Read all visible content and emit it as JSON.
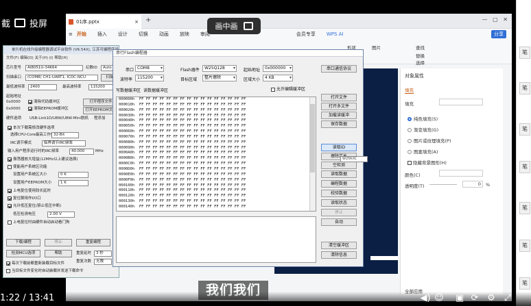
{
  "overlay": {
    "top_left_text_1": "截",
    "top_left_text_2": "投屏",
    "pip_label": "画中画",
    "subtitle": "我们我们",
    "timecode": "1:22 / 13:41"
  },
  "wps": {
    "file_tab": "01序.pptx",
    "ribbon_tabs": [
      "开始",
      "插入",
      "设计",
      "切换",
      "动画",
      "放映",
      "审阅"
    ],
    "ribbon_right": "会员专享",
    "wps_ai": "WPS AI",
    "share_label": "分享",
    "toolbar_items": [
      "形状",
      "图片",
      "查找",
      "替换",
      "选择"
    ],
    "panel_title": "对象属性",
    "panel_tab": "填充",
    "fill_label": "填充",
    "fill_options": [
      "纯色填充(S)",
      "渐变填充(G)",
      "图片或纹理填充(P)",
      "图案填充(A)",
      "隐藏背景图形(H)"
    ],
    "color_label": "颜色(C)",
    "transparency_label": "透明度(T)",
    "transparency_value": "0",
    "transparency_unit": "%",
    "apply_all": "全部应用"
  },
  "oldwin": {
    "title": "单片机在线升级编程器调试平台软件 (V6.54X), 江苏可编程序设备有限公司",
    "menu": "文件(F)  编辑(O)  关于(H)  (I)  帮助(H)",
    "chip_label": "芯片型号",
    "chip_value": "AI8051U-34K64",
    "chip_id_label": "幻数ID",
    "chip_id_value": "Auto",
    "scan_label": "扫描串口",
    "port_value": "(COM8) CH1-UART1, ICDC-NCU",
    "scan_btn": "扫描",
    "min_baud_label": "最低波特率",
    "min_baud_value": "2400",
    "max_baud_label": "最高波特率",
    "max_baud_value": "115200",
    "start_addr_label": "起始地址",
    "addr1": "0x0000",
    "addr2": "0x0000",
    "clear_code": "清除代码缓冲区",
    "clear_eeprom": "清除EEPROM缓冲区",
    "open_prog": "打开程序文件",
    "open_eeprom": "打开EEPROM文件",
    "hw_opts": "硬件选项",
    "usb_link": "USB-Link1D/U8W/U8W-Mini脱机",
    "prog_enc": "程序加",
    "opt1": "本次下载需修改硬件选项",
    "opt_cpu": "选择CPU-Core最高工作频率",
    "irc_label": "IRC频率",
    "irc_value": "32-Bit",
    "adj_label": "IRC调节模式",
    "adj_value": "临界调节IRC频率",
    "input_freq_label": "输入用户程序运行时的IRC频率",
    "input_freq_value": "40.000",
    "mhz": "MHz",
    "opt_vol": "振荡器放大增益(12MHz以上建议选择)",
    "opt_sys": "使能用户系统区功能",
    "sys_size_label": "设置用户系统区大小",
    "sys_size_value": "0 K",
    "eeprom_label": "设置用户EEPROM大小",
    "eeprom_value": "1 K",
    "opt_reset": "上电复位使用较长延时",
    "opt_p54": "复位脚用作I/O口",
    "opt_lvd": "允许低压复位(禁止低压中断)",
    "lvd_label": "低压检测电压",
    "lvd_value": "2.00 V",
    "opt_clear": "上电复位时由硬件自动启动看门狗",
    "download_btn": "下载/编程",
    "stop_btn": "停止",
    "reprog_btn": "重复编程",
    "check_mcu_btn": "检测MCU选项",
    "help_btn": "帮助",
    "repeat_delay_label": "重复延时",
    "repeat_delay_value": "3 秒",
    "repeat_count_label": "重复次数",
    "repeat_count_value": "无限",
    "reload_opt": "每次下载前都重新装载目标文件",
    "auto_send_opt": "当目标文件变化时自动装载并发送下载命令"
  },
  "dialog": {
    "title": "串行Flash编程器",
    "port_label": "串口",
    "port_value": "COM8",
    "baud_label": "波特率",
    "baud_value": "115200",
    "flash_label": "Flash器件",
    "flash_value": "W25Q128",
    "target_label": "目标区域",
    "target_value": "整片擦除",
    "start_label": "起始地址",
    "start_value": "0x000000",
    "size_label": "区域大小",
    "size_value": "4 KB",
    "comm_btn": "串口通信协议",
    "write_buf_label": "写数据缓冲区",
    "read_buf_label": "读数据缓冲区",
    "allow_edit": "允许编辑缓冲区",
    "right_buttons": [
      "打开文件",
      "打开多文件",
      "加载读缓冲",
      "保存数据",
      "读取ID",
      "擦除芯片",
      "空检测",
      "读取数据",
      "编程数据",
      "校验数据",
      "读取状态",
      "停止",
      "自动",
      "清空缓冲区",
      "清除信息"
    ],
    "hex_rows": [
      {
        "addr": "000000h",
        "data": "FF FF FF FF FF FF FF FF FF FF FF FF FF FF FF FF"
      },
      {
        "addr": "000010h",
        "data": "FF FF FF FF FF FF FF FF FF FF FF FF FF FF FF FF"
      },
      {
        "addr": "000020h",
        "data": "FF FF FF FF FF FF FF FF FF FF FF FF FF FF FF FF"
      },
      {
        "addr": "000030h",
        "data": "FF FF FF FF FF FF FF FF FF FF FF FF FF FF FF FF"
      },
      {
        "addr": "000040h",
        "data": "FF FF FF FF FF FF FF FF FF FF FF FF FF FF FF FF"
      },
      {
        "addr": "000050h",
        "data": "FF FF FF FF FF FF FF FF FF FF FF FF FF FF FF FF"
      },
      {
        "addr": "000060h",
        "data": "FF FF FF FF FF FF FF FF FF FF FF FF FF FF FF FF"
      },
      {
        "addr": "000070h",
        "data": "FF FF FF FF FF FF FF FF FF FF FF FF FF FF FF FF"
      },
      {
        "addr": "000080h",
        "data": "FF FF FF FF FF FF FF FF FF FF FF FF FF FF FF FF"
      },
      {
        "addr": "000090h",
        "data": "FF FF FF FF FF FF FF FF FF FF FF FF FF FF FF FF"
      },
      {
        "addr": "0000A0h",
        "data": "FF FF FF FF FF FF FF FF FF FF FF FF FF FF FF FF"
      },
      {
        "addr": "0000B0h",
        "data": "FF FF FF FF FF FF FF FF FF FF FF FF FF FF FF FF"
      },
      {
        "addr": "0000C0h",
        "data": "FF FF FF FF FF FF FF FF FF FF FF FF FF FF FF FF"
      },
      {
        "addr": "0000D0h",
        "data": "FF FF FF FF FF FF FF FF FF FF FF FF FF FF FF FF"
      },
      {
        "addr": "0000E0h",
        "data": "FF FF FF FF FF FF FF FF FF FF FF FF FF FF FF FF"
      },
      {
        "addr": "0000F0h",
        "data": "FF FF FF FF FF FF FF FF FF FF FF FF FF FF FF FF"
      },
      {
        "addr": "000100h",
        "data": "FF FF FF FF FF FF FF FF FF FF FF FF FF FF FF FF"
      },
      {
        "addr": "000110h",
        "data": "FF FF FF FF FF FF FF FF FF FF FF FF FF FF FF FF"
      },
      {
        "addr": "000120h",
        "data": "FF FF FF FF FF FF FF FF FF FF FF FF FF FF FF FF"
      },
      {
        "addr": "000130h",
        "data": "FF FF FF FF FF FF FF FF FF FF FF FF FF FF FF FF"
      },
      {
        "addr": "000140h",
        "data": "FF FF FF FF FF FF FF FF FF FF FF FF FF FF FF FF"
      }
    ],
    "tooltip": "W25KXC"
  },
  "colors": {
    "accent": "#c55a11",
    "dialog_border": "#6a7fa4",
    "slide_bg": "#0b1f44"
  }
}
